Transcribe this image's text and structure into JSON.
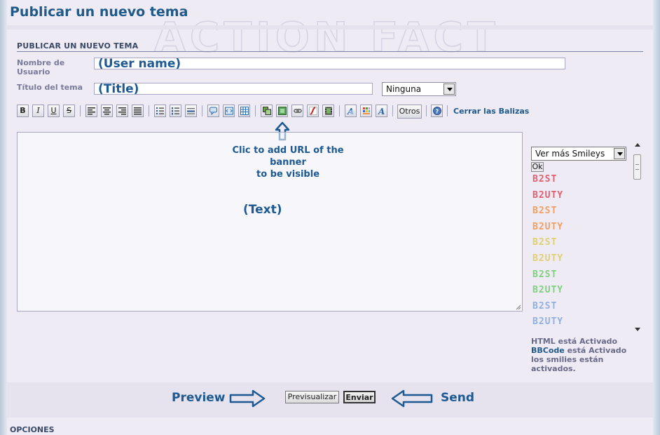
{
  "page": {
    "title": "Publicar un nuevo tema",
    "section_label": "PUBLICAR UN NUEVO TEMA",
    "options_label": "OPCIONES"
  },
  "form": {
    "username_label": "Nombre de Usuario",
    "title_label": "Título del tema",
    "title_select_value": "Ninguna"
  },
  "toolbar": {
    "bold_label": "B",
    "italic_label": "I",
    "underline_label": "U",
    "strike_label": "S",
    "otros_label": "Otros",
    "close_tags_label": "Cerrar las Balizas",
    "icons": [
      "bold-icon",
      "italic-icon",
      "underline-icon",
      "strike-icon",
      "align-left-icon",
      "align-center-icon",
      "align-right-icon",
      "justify-icon",
      "bullet-list-icon",
      "numbered-list-icon",
      "hr-icon",
      "quote-icon",
      "code-icon",
      "table-icon",
      "image-host-icon",
      "image-icon",
      "link-icon",
      "flash-icon",
      "video-icon",
      "font-icon",
      "color-icon",
      "font-size-icon",
      "help-icon"
    ]
  },
  "smileys": {
    "select_value": "Ver más Smileys",
    "ok_label": "Ok",
    "items": [
      {
        "text": "B2ST",
        "color": "#e06070"
      },
      {
        "text": "B2UTY",
        "color": "#e06070"
      },
      {
        "text": "B2ST",
        "color": "#f0a060"
      },
      {
        "text": "B2UTY",
        "color": "#f0a060"
      },
      {
        "text": "B2ST",
        "color": "#e0d070"
      },
      {
        "text": "B2UTY",
        "color": "#e0d070"
      },
      {
        "text": "B2ST",
        "color": "#80d080"
      },
      {
        "text": "B2UTY",
        "color": "#80d080"
      },
      {
        "text": "B2ST",
        "color": "#90b0e0"
      },
      {
        "text": "B2UTY",
        "color": "#90b0e0"
      }
    ]
  },
  "status": {
    "html_line": "HTML está Activado",
    "bbcode_link": "BBCode",
    "bbcode_rest": " está Activado",
    "smilies_line": "los smilies están activados."
  },
  "buttons": {
    "preview_label": "Previsualizar",
    "send_label": "Enviar"
  },
  "annotations": {
    "user_name": "(User name)",
    "title": "(Title)",
    "banner_line1": "Clic to add URL of the banner",
    "banner_line2": "to be visible",
    "text": "(Text)",
    "preview": "Preview",
    "send": "Send"
  },
  "colors": {
    "accent": "#1f5a8a",
    "annotation": "#1d5a94",
    "page_bg": "#eeebf4"
  }
}
